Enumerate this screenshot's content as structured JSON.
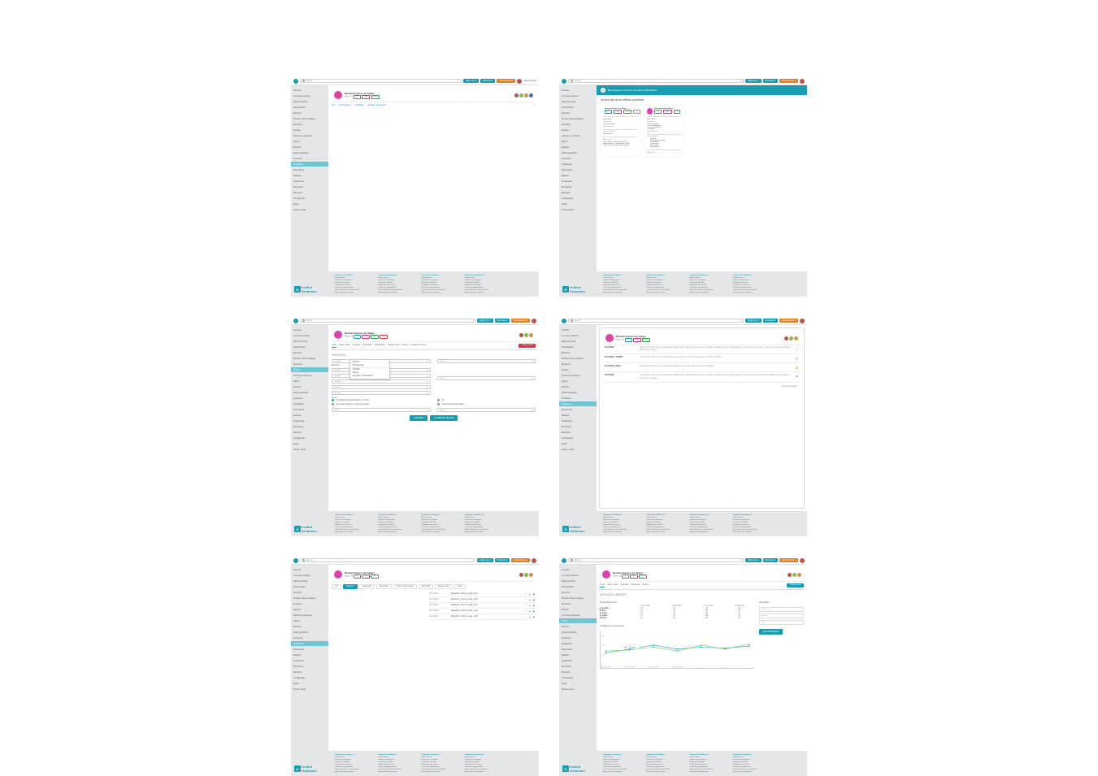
{
  "topbar": {
    "search_placeholder": "Buscar",
    "btn_category": "Afegir nou ▾",
    "btn_action": "Recursos ▾",
    "btn_admin": "Administració ▾",
    "user_label": "Carme Garcia"
  },
  "sidebar": {
    "items": [
      "General",
      "Les teves pacients",
      "Salut i benestar",
      "Nutrició/dieta",
      "Exercicis",
      "Prendre notes mèdiques",
      "Emocions",
      "Escales",
      "Informes i preguntes",
      "Idioma",
      "Escriure",
      "Ajuda registrada",
      "Contenido",
      "Cuidadores",
      "Fitxa actual",
      "Material",
      "Audiovisual",
      "Pla d'acció",
      "Educació",
      "Configuració",
      "Ajuda",
      "Tancar sessió"
    ],
    "active_idx_s1": 13,
    "active_idx_s3": 7,
    "active_idx_s4": 13,
    "active_idx_s5": 13,
    "active_idx_s6": 9
  },
  "patient": {
    "name": "Noemia Fumero de Alegre",
    "meta": "Edad: 56",
    "tags": [
      "DT",
      "LBF",
      "ESP"
    ],
    "tag_classes": [
      "teal",
      "pink",
      "green"
    ]
  },
  "breadcrumb": [
    "Inici",
    "Fitxa pacient",
    "Cuidadors",
    "Escales d'avaluació"
  ],
  "avatars_count": 4,
  "screen2": {
    "banner": "Benvinguda a la Xarxa del Neurorehabilitació",
    "title": "Accés als teus últims pacients",
    "cards": [
      {
        "name": "Noemia Fumero de Alegre",
        "tags": [
          "DT",
          "LBF",
          "ESP",
          "+1"
        ],
        "edat": "Edat: 56/72",
        "diag_label": "Diagnòstic",
        "diag": "• Dany cerebral",
        "proc_label": "Procediments",
        "estat_label": "Estat i ubicació",
        "estat": "• Ambulatori",
        "cli_label": "Alta clínica",
        "cli": "Clare Oliver - Metge de Recerca\nAntoni Reixac - Treballador social\nCarme Garcia - Neuropsicologia"
      },
      {
        "name": "Noemi María de Alegre",
        "tags": [
          "DT",
          "PRA",
          "+2"
        ],
        "edat": "Edat: 56/72",
        "diag_label": "Diagnòstic",
        "diag": "• Dany cerebral\n• Ictus hemorràgic\n• Lesió medul·lar\n• Isquèmic",
        "proc_label": "Procediments",
        "estat_label": "Estat i ubicació",
        "estat_list": [
          "Domicili",
          "A l'hospital externa",
          "A l'hospital",
          "Teleatenció",
          "A consulta",
          "A urgències"
        ],
        "cli_label": "Alta clínica"
      }
    ]
  },
  "screen3": {
    "tabs": [
      "Visita",
      "Salut i estils",
      "Cognició",
      "Psicologia",
      "Fisioteràpia",
      "Treball social",
      "Resum",
      "Terapèutic social"
    ],
    "active_tab": 1,
    "right_btn": "+ Afegir domini",
    "title": "WHOQOL",
    "dropdown_main": {
      "selected": "Família",
      "options": [
        "Família",
        "Professionals",
        "PROMS",
        "Suport",
        "Al·lèrgies i intoleràncies"
      ]
    },
    "fields_left": [
      "Família 1",
      "Família 2",
      "Família 3",
      "Família 4",
      "Família 5"
    ],
    "fields_right": [
      "Tipus 1",
      "Tipus 2"
    ],
    "radio_q": "Teniu?",
    "radio_opts_col1": [
      "Quantitat de fills dependents = la meva",
      "Necessita cuidador / persona de suport"
    ],
    "radio_opts_col2": [
      "Un",
      "Conviu amb altres familiars"
    ],
    "bottom_selects": [
      "Tipus 1",
      "Tipus 2"
    ],
    "btn_save": "GUARDAR",
    "btn_save_send": "GUARDAR I ENVIAR"
  },
  "screen4": {
    "entries": [
      {
        "date": "01.10.2022",
        "txt": "Lorem ipsum dolor sit amet, consectetur adipiscing elit, sed do eiusmod tempor incididunt ut labore et dolore magna aliqua. Ut enim ad minim veniam, quis nostrud exercitation ullamco laboris nisi ut aliquip.",
        "icon": "📄"
      },
      {
        "date": "01.10.2022 – SCPAN",
        "txt": "Lorem ipsum dolor sit amet, consectetur adipiscing elit, sed do eiusmod tempor incididunt ut labore.",
        "icon": "💬"
      },
      {
        "date": "01.10.2022 · Maria",
        "txt": "Lorem ipsum dolor sit amet, consectetur adipiscing elit, sed do eiusmod tempor incididunt.",
        "icon": "🔔"
      },
      {
        "date": "01.10.2022",
        "txt": "Lorem ipsum dolor sit amet, consectetur adipiscing elit, sed do eiusmod tempor incididunt ut labore et dolore magna aliqua. Ut enim ad minim veniam ullamco laboris nisi ut aliquip ex commodo consequat.",
        "icon": "⊞"
      }
    ],
    "footer_link": "Veure continuació →"
  },
  "screen5": {
    "subtabs": [
      "Tots",
      "Sessions",
      "Anamnesis",
      "Exploració",
      "Informe final evolutiu",
      "Ortopèdia",
      "Report extern",
      "Altres"
    ],
    "active_sub": 1,
    "files": [
      {
        "date": "01.10.2022",
        "name": "Diagnòstic_informe_terap_1.pdf"
      },
      {
        "date": "01.10.2022",
        "name": "Diagnòstic_informe_terap_1.pdf"
      },
      {
        "date": "01.10.2022",
        "name": "Diagnòstic_informe_terap_1.pdf"
      },
      {
        "date": "01.10.2022",
        "name": "Diagnòstic_informe_terap_1.pdf"
      },
      {
        "date": "01.10.2022",
        "name": "Diagnòstic_informe_terap_1.pdf"
      }
    ],
    "file_icons": [
      "⤓",
      "📊",
      "▶"
    ]
  },
  "screen6": {
    "tabs": [
      "Visita",
      "Salut i estils",
      "Cognició",
      "Psicologia",
      "Resum"
    ],
    "title": "WHOQOL-BREAF",
    "resp_label": "Nova Resposta",
    "result_label": "Resultats",
    "cols": [
      "",
      "02.04.2021",
      "02.04.2021",
      "17.04.2022",
      "20.08.2022"
    ],
    "rows": [
      {
        "lbl": "F. de salut",
        "vals": [
          "12",
          "16",
          "20",
          "16"
        ]
      },
      {
        "lbl": "B. físic",
        "vals": [
          "12",
          "16",
          "20",
          "16"
        ]
      },
      {
        "lbl": "B. psicol.",
        "vals": [
          "12",
          "16",
          "20",
          "16"
        ]
      },
      {
        "lbl": "R. social",
        "vals": [
          "12",
          "16",
          "20",
          "16"
        ]
      },
      {
        "lbl": "Ambient",
        "vals": [
          "12",
          "16",
          "20",
          "16"
        ]
      }
    ],
    "sum": "—",
    "btn_new": "NOU REGISTRE",
    "side_fields": [
      "Filtrar per",
      "Ítem de",
      "Ítem"
    ],
    "chart_label": "Gràfiques comparades"
  },
  "chart_data": {
    "type": "line",
    "x": [
      "02.04.2021",
      "02.04.2021",
      "17.04.2022",
      "20.08.2022",
      "—",
      "—",
      "—"
    ],
    "series": [
      {
        "name": "F. de salut",
        "color": "#2aa7c9",
        "values": [
          12,
          16,
          20,
          16,
          18,
          17,
          19
        ]
      },
      {
        "name": "B. físic",
        "color": "#6ecb63",
        "values": [
          14,
          15,
          18,
          14,
          20,
          16,
          21
        ]
      }
    ],
    "ylim": [
      0,
      30
    ],
    "yticks": [
      0,
      10,
      20,
      30
    ],
    "annot": {
      "x": 1,
      "y": 16,
      "label": "16 · Prom"
    }
  },
  "footer": {
    "cols": [
      {
        "head": "Categoria d'enllaços 1",
        "links": [
          "Enllaç extern",
          "Gestor de continguts",
          "Programa d'ajudes",
          "Programa de recerca",
          "Caixa de suggeriments",
          "Línia d'educació sexo-afectiva",
          "Blog informatiu primària"
        ]
      },
      {
        "head": "Categoria d'enllaços 2",
        "links": [
          "Enllaç extern",
          "Gestor de continguts",
          "Programa d'ajudes",
          "Programa de recerca",
          "Caixa de suggeriments",
          "Línia d'educació sexo-afectiva",
          "Blog informatiu primària"
        ]
      },
      {
        "head": "Categoria d'enllaços 3",
        "links": [
          "Enllaç extern",
          "Gestor de continguts",
          "Programa d'ajudes",
          "Programa de recerca",
          "Caixa de suggeriments",
          "Línia d'educació sexo-afectiva",
          "Blog informatiu primària"
        ]
      },
      {
        "head": "Categoria d'enllaços 4",
        "links": [
          "Enllaç extern",
          "Gestor de continguts",
          "Programa d'ajudes",
          "Programa de recerca",
          "Caixa de suggeriments",
          "Línia d'educació sexo-afectiva",
          "Blog informatiu primària"
        ]
      }
    ],
    "logo": "Institut Guttmann"
  }
}
